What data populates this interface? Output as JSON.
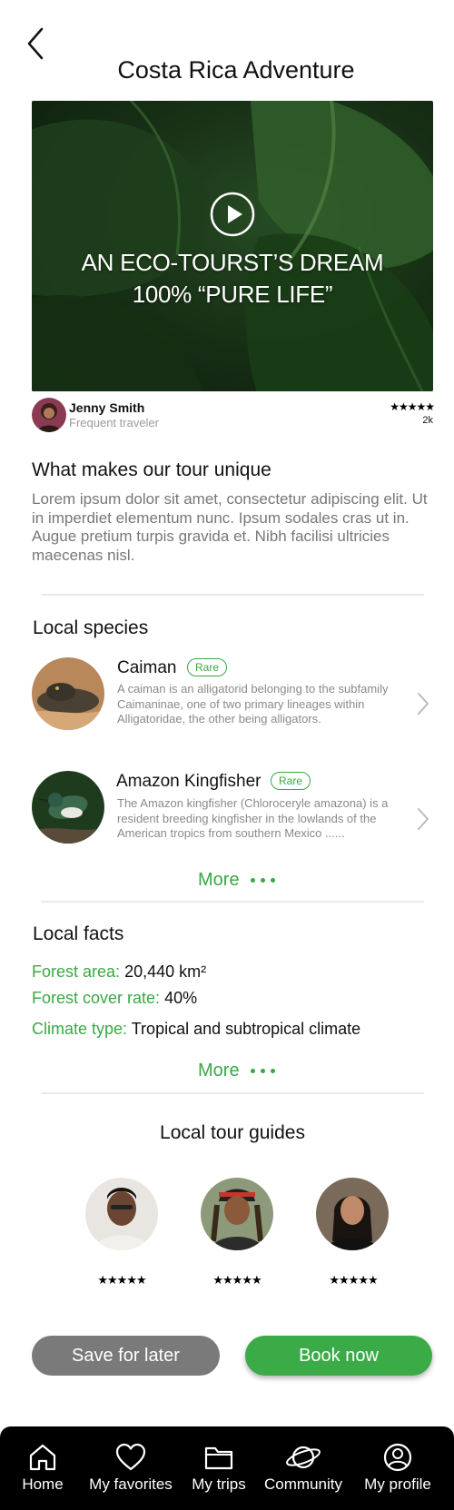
{
  "header": {
    "title": "Costa Rica Adventure"
  },
  "hero": {
    "line1": "AN ECO-TOURST’S DREAM",
    "line2": "100% “PURE LIFE”"
  },
  "author": {
    "name": "Jenny Smith",
    "role": "Frequent traveler",
    "stars": "★★★★★",
    "rating_count": "2k"
  },
  "unique": {
    "heading": "What makes our tour unique",
    "body": "Lorem ipsum dolor sit amet, consectetur adipiscing elit. Ut in imperdiet elementum nunc. Ipsum sodales cras ut in. Augue pretium turpis gravida et. Nibh facilisi ultricies maecenas nisl."
  },
  "species": {
    "heading": "Local species",
    "items": [
      {
        "name": "Caiman",
        "badge": "Rare",
        "desc": "A caiman is an alligatorid belonging to the subfamily Caimaninae, one of two primary lineages within Alligatoridae, the other being alligators."
      },
      {
        "name": "Amazon Kingfisher",
        "badge": "Rare",
        "desc": "The Amazon kingfisher (Chloroceryle amazona) is a resident breeding kingfisher in the lowlands of the American tropics from southern Mexico ......"
      }
    ],
    "more_label": "More"
  },
  "facts": {
    "heading": "Local facts",
    "items": [
      {
        "label": "Forest area:",
        "value": "20,440 km²"
      },
      {
        "label": "Forest cover rate:",
        "value": "40%"
      },
      {
        "label": "Climate type:",
        "value": "Tropical and subtropical climate"
      }
    ],
    "more_label": "More"
  },
  "guides": {
    "heading": "Local tour guides",
    "items": [
      {
        "stars": "★★★★★"
      },
      {
        "stars": "★★★★★"
      },
      {
        "stars": "★★★★★"
      }
    ]
  },
  "actions": {
    "save_label": "Save for later",
    "book_label": "Book now"
  },
  "tabbar": {
    "items": [
      {
        "label": "Home",
        "icon": "home-icon"
      },
      {
        "label": "My favorites",
        "icon": "heart-icon"
      },
      {
        "label": "My trips",
        "icon": "folder-icon"
      },
      {
        "label": "Community",
        "icon": "planet-icon"
      },
      {
        "label": "My profile",
        "icon": "user-circle-icon"
      }
    ]
  },
  "colors": {
    "accent": "#3aab47",
    "secondary_button": "#7a7a7a",
    "tabbar_bg": "#000000",
    "text_muted": "#777777"
  }
}
